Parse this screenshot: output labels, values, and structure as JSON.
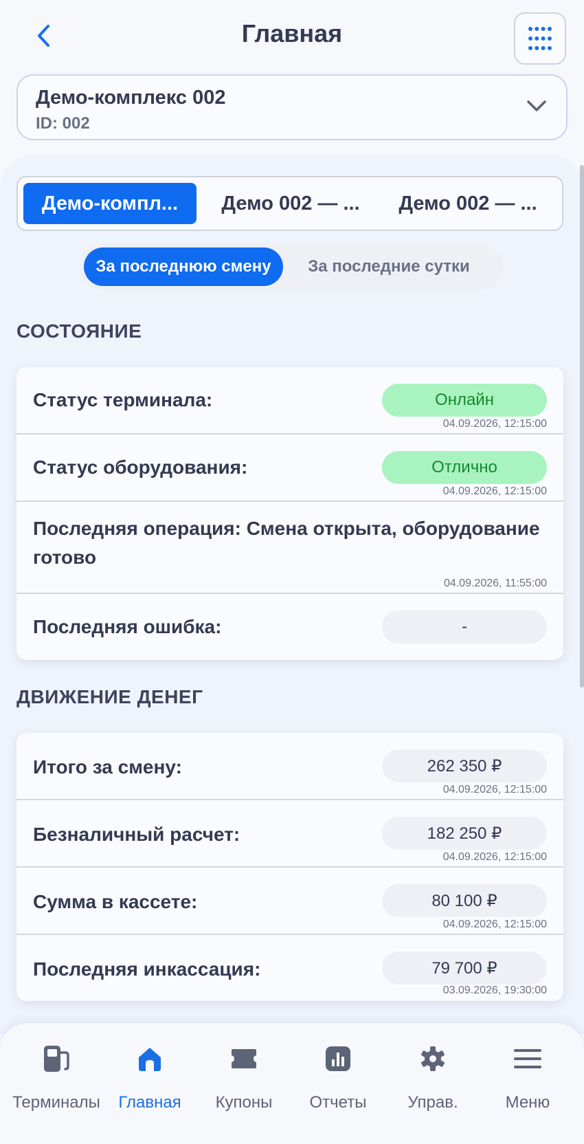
{
  "header": {
    "title": "Главная"
  },
  "selector": {
    "name": "Демо-комплекс 002",
    "id_label": "ID: 002"
  },
  "tabs": [
    {
      "label": "Демо-компл..."
    },
    {
      "label": "Демо 002 — ..."
    },
    {
      "label": "Демо 002 — ..."
    }
  ],
  "period": [
    {
      "label": "За последнюю смену"
    },
    {
      "label": "За последние сутки"
    }
  ],
  "state": {
    "title": "СОСТОЯНИЕ",
    "terminal": {
      "label": "Статус терминала:",
      "value": "Онлайн",
      "ts": "04.09.2026, 12:15:00"
    },
    "equipment": {
      "label": "Статус оборудования:",
      "value": "Отлично",
      "ts": "04.09.2026, 12:15:00"
    },
    "last_op": {
      "label": "Последняя операция: Смена открыта, оборудование готово",
      "ts": "04.09.2026, 11:55:00"
    },
    "last_error": {
      "label": "Последняя ошибка:",
      "value": "-"
    }
  },
  "money": {
    "title": "ДВИЖЕНИЕ ДЕНЕГ",
    "rows": [
      {
        "label": "Итого за смену:",
        "value": "262 350 ₽",
        "ts": "04.09.2026, 12:15:00"
      },
      {
        "label": "Безналичный расчет:",
        "value": "182 250 ₽",
        "ts": "04.09.2026, 12:15:00"
      },
      {
        "label": "Сумма в кассете:",
        "value": "80 100 ₽",
        "ts": "04.09.2026, 12:15:00"
      },
      {
        "label": "Последняя инкассация:",
        "value": "79 700 ₽",
        "ts": "03.09.2026, 19:30:00"
      }
    ]
  },
  "nav": [
    {
      "label": "Терминалы",
      "icon": "fuel-pump-icon"
    },
    {
      "label": "Главная",
      "icon": "home-icon"
    },
    {
      "label": "Купоны",
      "icon": "ticket-icon"
    },
    {
      "label": "Отчеты",
      "icon": "chart-icon"
    },
    {
      "label": "Управ.",
      "icon": "gear-icon"
    },
    {
      "label": "Меню",
      "icon": "hamburger-icon"
    }
  ],
  "colors": {
    "accent": "#0f6bf0",
    "success_bg": "#a9f3c0",
    "success_text": "#128a2c"
  }
}
